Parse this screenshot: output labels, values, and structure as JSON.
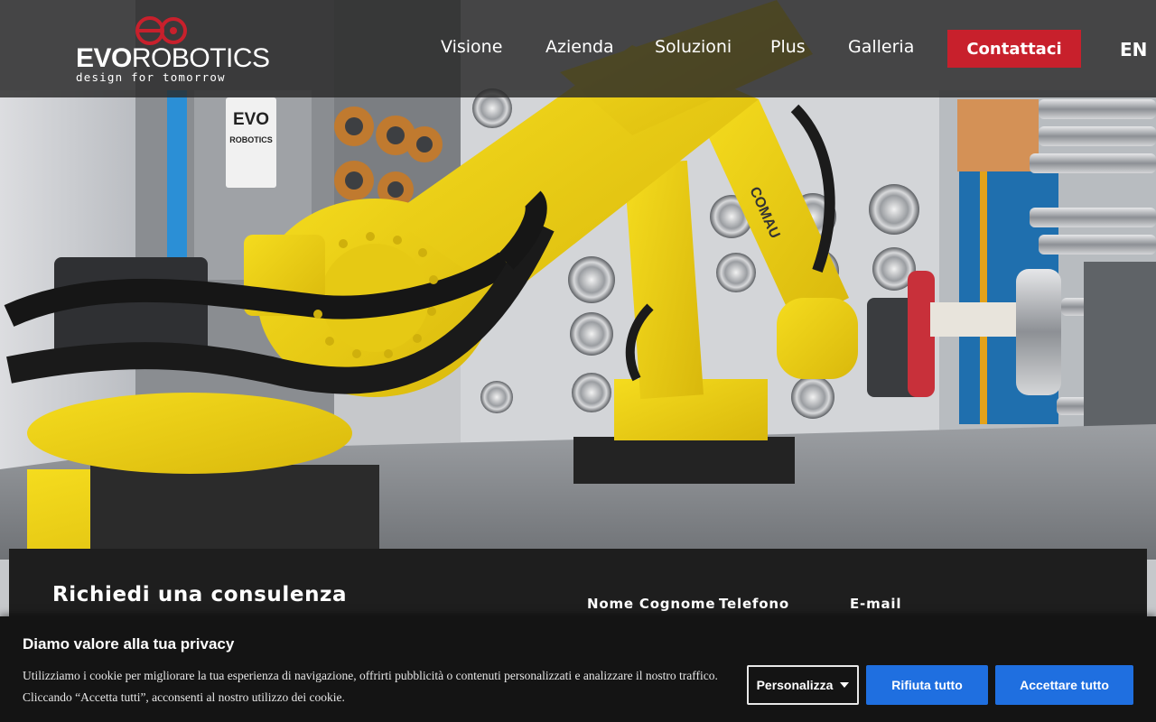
{
  "brand": {
    "word_bold": "EVO",
    "word_light": "ROBOTICS",
    "tagline": "design for tomorrow",
    "accent_color": "#c8202c"
  },
  "nav": {
    "items": [
      "Visione",
      "Azienda",
      "Soluzioni",
      "Plus",
      "Galleria"
    ],
    "cta": "Contattaci",
    "language": "EN"
  },
  "hero": {
    "sign_line1": "EVO",
    "sign_line2": "ROBOTICS",
    "robot_brand": "COMAU"
  },
  "consult": {
    "title": "Richiedi una consulenza",
    "fields": [
      "Nome Cognome",
      "Telefono",
      "E-mail"
    ]
  },
  "cookie": {
    "title": "Diamo valore alla tua privacy",
    "text": "Utilizziamo i cookie per migliorare la tua esperienza di navigazione, offrirti pubblicità o contenuti personalizzati e analizzare il nostro traffico. Cliccando “Accetta tutti”, acconsenti al nostro utilizzo dei cookie.",
    "customize": "Personalizza",
    "reject": "Rifiuta tutto",
    "accept": "Accettare tutto",
    "button_color": "#1f6fe0"
  }
}
